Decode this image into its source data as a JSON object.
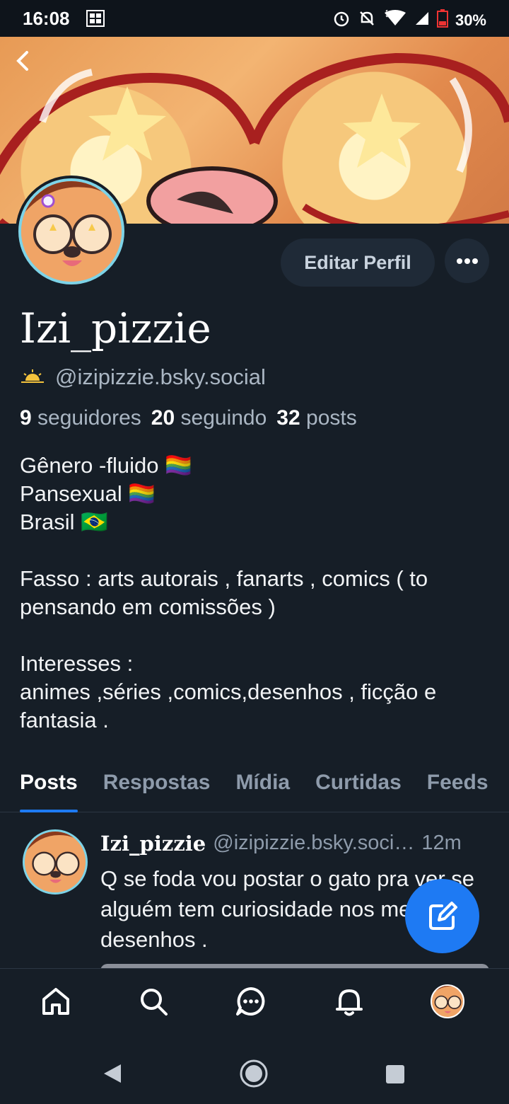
{
  "status_bar": {
    "time": "16:08",
    "battery": "30%"
  },
  "profile": {
    "display_name": "Izi_pizzie",
    "handle": "@izipizzie.bsky.social",
    "edit_button": "Editar Perfil",
    "followers_count": "9",
    "followers_label": "seguidores",
    "following_count": "20",
    "following_label": "seguindo",
    "posts_count": "32",
    "posts_label": "posts",
    "bio": "Gênero -fluido 🏳️‍🌈\nPansexual 🏳️‍🌈\nBrasil 🇧🇷\n\nFasso : arts autorais , fanarts , comics ( to pensando em comissões )\n\nInteresses :\nanimes ,séries ,comics,desenhos , ficção e fantasia ."
  },
  "tabs": [
    "Posts",
    "Respostas",
    "Mídia",
    "Curtidas",
    "Feeds"
  ],
  "post": {
    "author": "Izi_pizzie",
    "handle": "@izipizzie.bsky.soci…",
    "time": "12m",
    "text": "Q se foda vou postar o gato pra ver se alguém tem curiosidade nos meus desenhos ."
  },
  "nav": [
    "home-icon",
    "search-icon",
    "chat-icon",
    "bell-icon",
    "profile-avatar"
  ],
  "colors": {
    "accent": "#1e7af3",
    "background": "#161e27"
  }
}
